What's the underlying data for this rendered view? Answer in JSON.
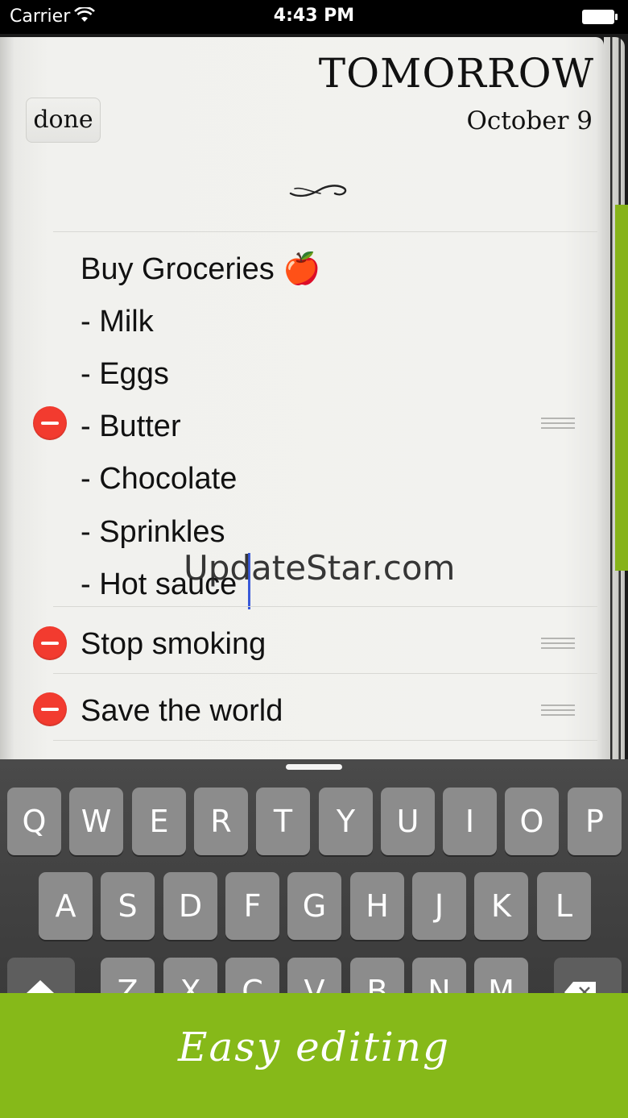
{
  "status_bar": {
    "carrier": "Carrier",
    "time": "4:43 PM"
  },
  "header": {
    "title": "TOMORROW",
    "date": "October 9",
    "done_label": "done"
  },
  "items": [
    {
      "lines": [
        "Buy Groceries 🍎",
        "- Milk",
        "- Eggs",
        "- Butter",
        "- Chocolate",
        "- Sprinkles",
        "- Hot sauce"
      ]
    },
    {
      "lines": [
        "Stop smoking"
      ]
    },
    {
      "lines": [
        "Save the world"
      ]
    }
  ],
  "watermark": "UpdateStar.com",
  "keyboard": {
    "row1": [
      "Q",
      "W",
      "E",
      "R",
      "T",
      "Y",
      "U",
      "I",
      "O",
      "P"
    ],
    "row2": [
      "A",
      "S",
      "D",
      "F",
      "G",
      "H",
      "J",
      "K",
      "L"
    ],
    "row3": [
      "Z",
      "X",
      "C",
      "V",
      "B",
      "N",
      "M"
    ]
  },
  "banner": {
    "text": "Easy editing"
  },
  "colors": {
    "accent_green": "#86b919",
    "delete_red": "#f23b2f",
    "caret_blue": "#3a5ad9"
  }
}
